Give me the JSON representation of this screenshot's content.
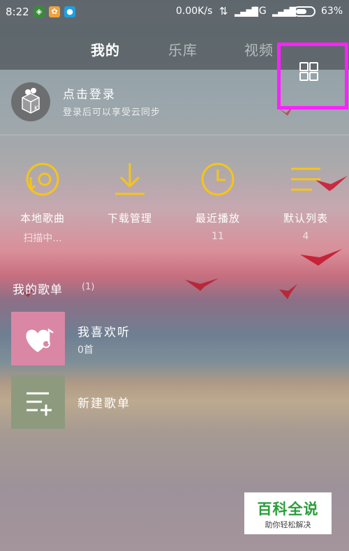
{
  "status_bar": {
    "time": "8:22",
    "speed": "0.00K/s",
    "network": "3G",
    "battery": "63%",
    "battery_level": 0.63
  },
  "nav": {
    "tabs": [
      "我的",
      "乐库",
      "视频"
    ],
    "active_tab": "我的"
  },
  "login": {
    "title": "点击登录",
    "subtitle": "登录后可以享受云同步"
  },
  "quick": [
    {
      "label": "本地歌曲",
      "sub": "扫描中...",
      "icon": "disc-icon"
    },
    {
      "label": "下载管理",
      "sub": "",
      "icon": "download-icon"
    },
    {
      "label": "最近播放",
      "sub": "11",
      "icon": "clock-icon"
    },
    {
      "label": "默认列表",
      "sub": "4",
      "icon": "list-icon"
    }
  ],
  "playlists_section": {
    "title": "我的歌单",
    "count": "(1)",
    "items": [
      {
        "title": "我喜欢听",
        "sub": "0首",
        "icon": "heart-note-icon"
      },
      {
        "title": "新建歌单",
        "sub": "",
        "icon": "add-list-icon"
      }
    ]
  },
  "watermark": {
    "title": "百科全说",
    "subtitle": "助你轻松解决"
  },
  "colors": {
    "accent": "#f5c518",
    "highlight_box": "#ff20ff",
    "fav_bg": "#d987a5",
    "new_bg": "#8d9a7e"
  }
}
